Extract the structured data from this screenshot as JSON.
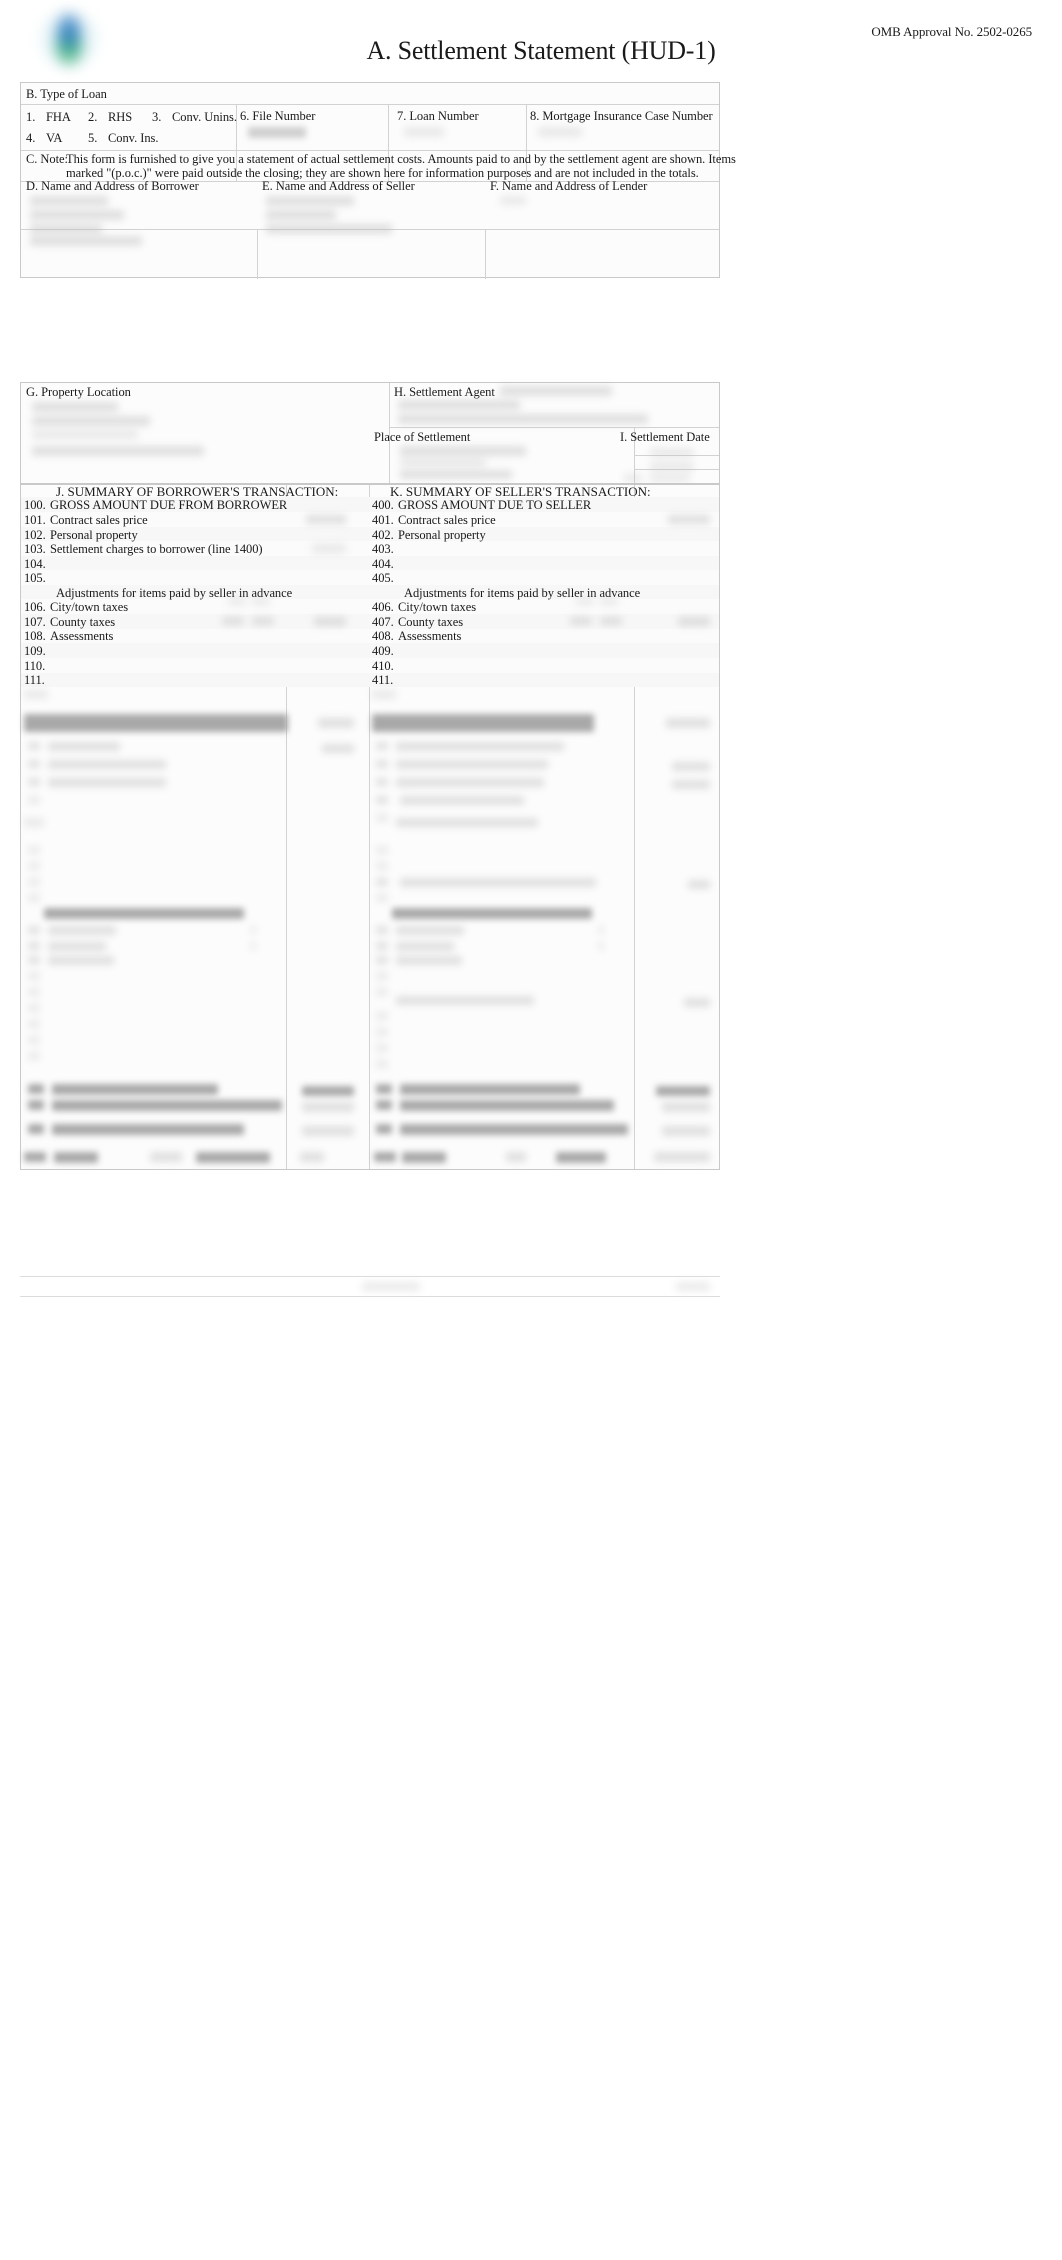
{
  "document": {
    "title": "A. Settlement Statement (HUD-1)",
    "omb": "OMB Approval No. 2502-0265",
    "logo_icon": "company-logo-gradient-oval"
  },
  "section_b": {
    "heading": "B. Type of Loan",
    "loan_types": [
      {
        "num": "1.",
        "label": "FHA"
      },
      {
        "num": "2.",
        "label": "RHS"
      },
      {
        "num": "3.",
        "label": "Conv. Unins."
      },
      {
        "num": "4.",
        "label": "VA"
      },
      {
        "num": "5.",
        "label": "Conv. Ins."
      }
    ],
    "file_number_label": "6. File Number",
    "file_number_value": "",
    "loan_number_label": "7. Loan Number",
    "loan_number_value": "",
    "mic_label": "8. Mortgage Insurance Case Number",
    "mic_value": ""
  },
  "section_c": {
    "prefix": "C. Note:",
    "line1": "This form is furnished to give you a statement of actual settlement costs. Amounts paid to and by the settlement agent are shown. Items",
    "line2": "marked \"(p.o.c.)\" were paid outside the closing; they are shown here for information purposes and are not included in the totals."
  },
  "section_def": {
    "borrower_label": "D. Name and Address of Borrower",
    "borrower_value": "",
    "seller_label": "E. Name and Address of Seller",
    "seller_value": "",
    "lender_label": "F. Name and Address of Lender",
    "lender_value": ""
  },
  "section_ghi": {
    "property_label": "G. Property Location",
    "property_value": "",
    "agent_label": "H. Settlement Agent",
    "agent_value": "",
    "place_label": "Place of Settlement",
    "place_value": "",
    "date_label": "I. Settlement Date",
    "date_value": ""
  },
  "summary": {
    "borrower_heading": "J. SUMMARY OF BORROWER'S TRANSACTION:",
    "seller_heading": "K. SUMMARY OF SELLER'S TRANSACTION:",
    "borrower_gross": {
      "num": "100.",
      "label": "GROSS AMOUNT DUE FROM BORROWER"
    },
    "seller_gross": {
      "num": "400.",
      "label": "GROSS AMOUNT DUE TO SELLER"
    },
    "adjustments_note_borrower": "Adjustments for items paid by seller in advance",
    "adjustments_note_seller": "Adjustments for items paid by seller in advance",
    "borrower_rows": [
      {
        "num": "101.",
        "label": "Contract sales price",
        "value": ""
      },
      {
        "num": "102.",
        "label": "Personal property",
        "value": ""
      },
      {
        "num": "103.",
        "label": "Settlement charges to borrower (line 1400)",
        "value": ""
      },
      {
        "num": "104.",
        "label": "",
        "value": ""
      },
      {
        "num": "105.",
        "label": "",
        "value": ""
      },
      {
        "num": "106.",
        "label": "City/town taxes",
        "value": ""
      },
      {
        "num": "107.",
        "label": "County taxes",
        "value": ""
      },
      {
        "num": "108.",
        "label": "Assessments",
        "value": ""
      },
      {
        "num": "109.",
        "label": "",
        "value": ""
      },
      {
        "num": "110.",
        "label": "",
        "value": ""
      },
      {
        "num": "111.",
        "label": "",
        "value": ""
      }
    ],
    "seller_rows": [
      {
        "num": "401.",
        "label": "Contract sales price",
        "value": ""
      },
      {
        "num": "402.",
        "label": "Personal property",
        "value": ""
      },
      {
        "num": "403.",
        "label": "",
        "value": ""
      },
      {
        "num": "404.",
        "label": "",
        "value": ""
      },
      {
        "num": "405.",
        "label": "",
        "value": ""
      },
      {
        "num": "406.",
        "label": "City/town taxes",
        "value": ""
      },
      {
        "num": "407.",
        "label": "County taxes",
        "value": ""
      },
      {
        "num": "408.",
        "label": "Assessments",
        "value": ""
      },
      {
        "num": "409.",
        "label": "",
        "value": ""
      },
      {
        "num": "410.",
        "label": "",
        "value": ""
      },
      {
        "num": "411.",
        "label": "",
        "value": ""
      }
    ]
  },
  "redacted_note": "Lower summary sections (lines 112-220 / 412-520), disbursement totals, and the page footer are visually redacted in this screenshot and contain no legible text."
}
